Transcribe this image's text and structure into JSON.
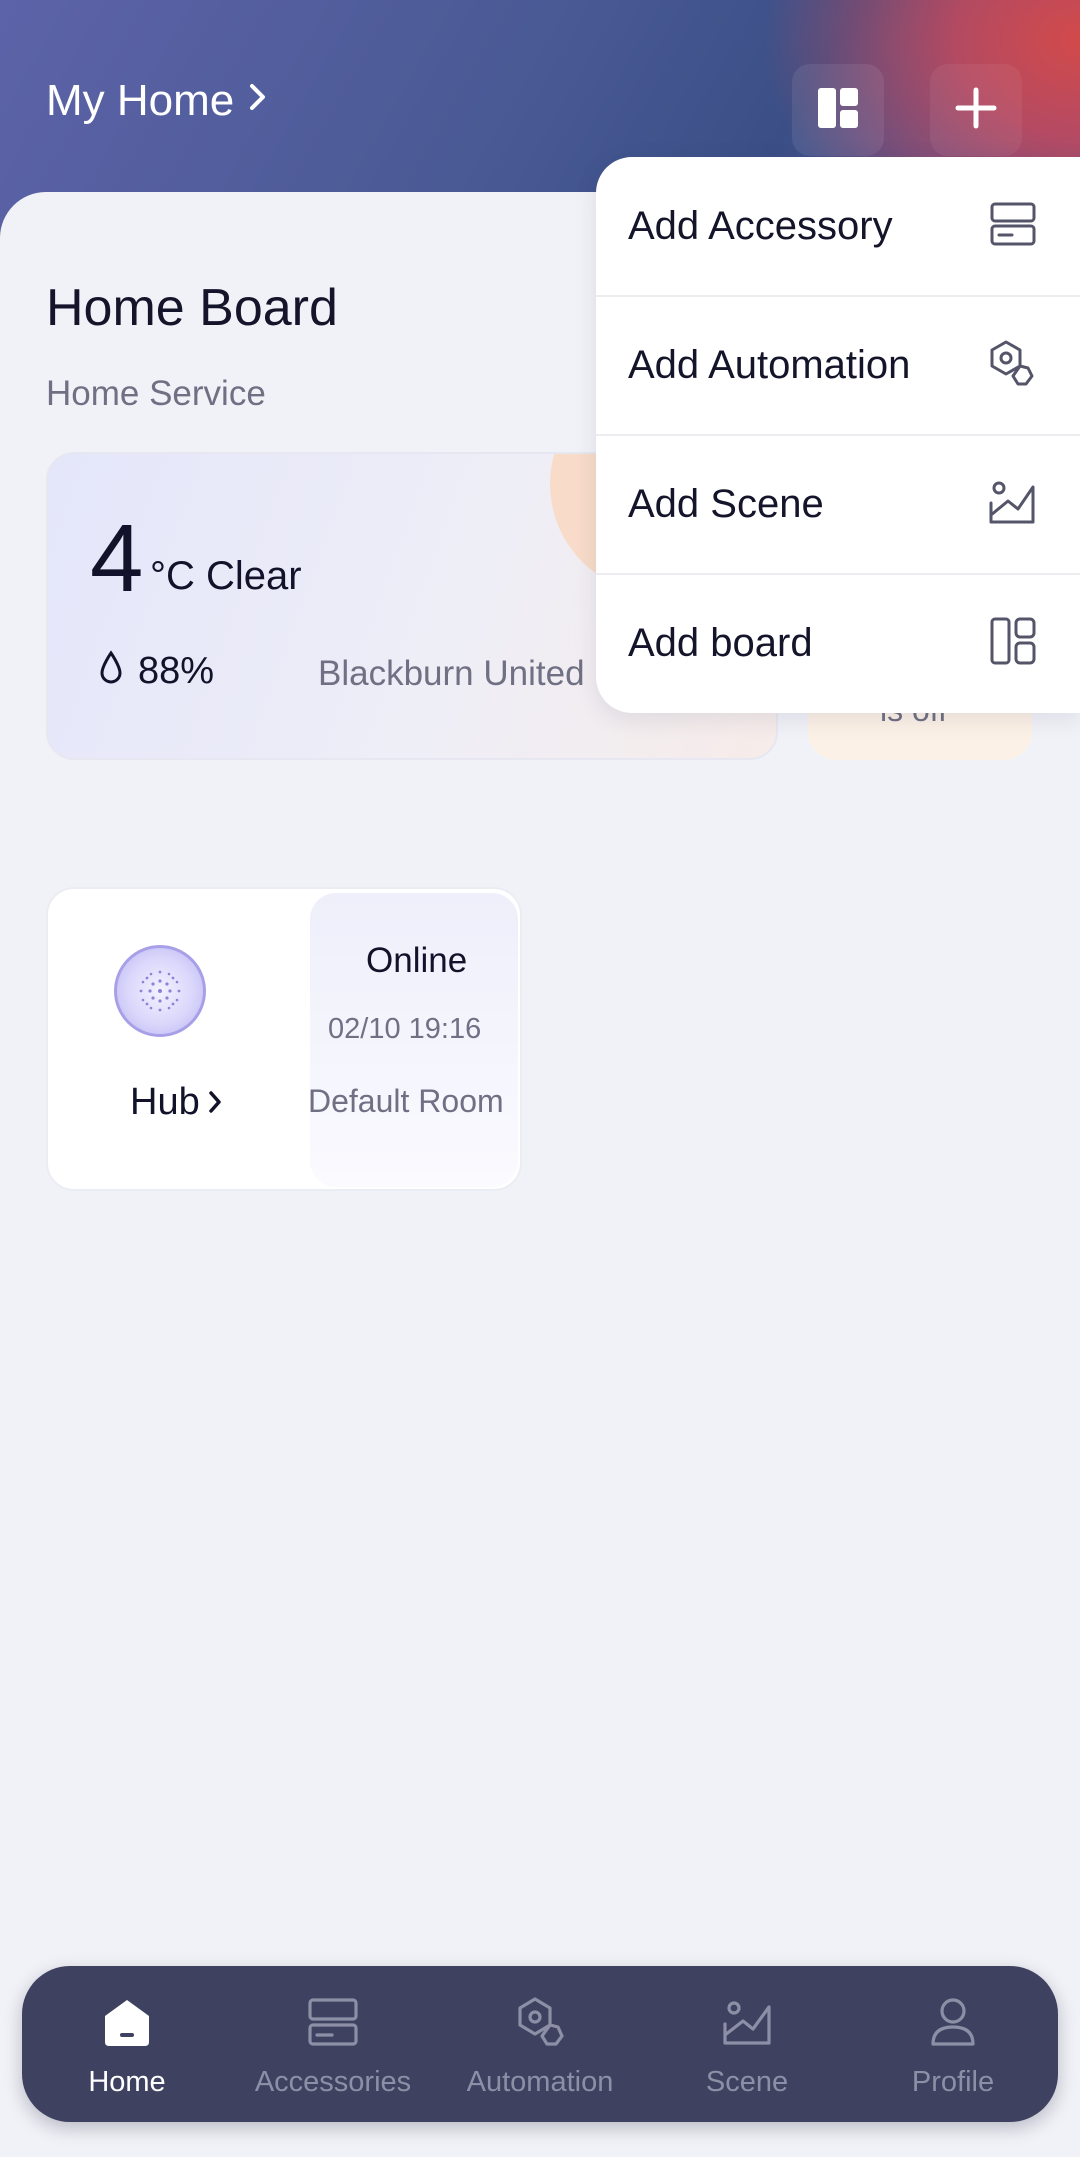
{
  "header": {
    "home_name": "My Home",
    "layout_button_icon": "layout-grid-icon",
    "add_button_icon": "plus-icon"
  },
  "board": {
    "title": "Home Board",
    "subtitle": "Home Service"
  },
  "weather": {
    "temperature": "4",
    "unit_condition": "°C Clear",
    "humidity": "88%",
    "location": "Blackburn United"
  },
  "side_card": {
    "text": "is off"
  },
  "hub": {
    "name": "Hub",
    "status": "Online",
    "timestamp": "02/10 19:16",
    "room": "Default Room"
  },
  "menu": {
    "items": [
      {
        "label": "Add Accessory",
        "icon": "accessory-icon"
      },
      {
        "label": "Add Automation",
        "icon": "automation-icon"
      },
      {
        "label": "Add Scene",
        "icon": "scene-icon"
      },
      {
        "label": "Add board",
        "icon": "board-icon"
      }
    ]
  },
  "tabbar": {
    "items": [
      {
        "label": "Home",
        "icon": "home-icon",
        "active": true
      },
      {
        "label": "Accessories",
        "icon": "accessories-icon",
        "active": false
      },
      {
        "label": "Automation",
        "icon": "automation-icon",
        "active": false
      },
      {
        "label": "Scene",
        "icon": "scene-icon",
        "active": false
      },
      {
        "label": "Profile",
        "icon": "profile-icon",
        "active": false
      }
    ]
  },
  "colors": {
    "tabbar_bg": "#3f4160",
    "page_bg": "#f1f2f7",
    "accent": "#a7a0e8"
  }
}
